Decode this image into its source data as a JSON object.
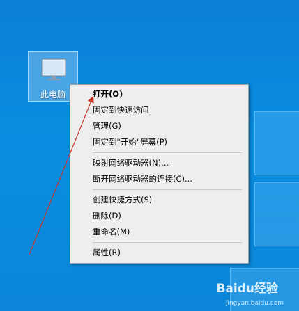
{
  "desktop": {
    "icon": {
      "label": "此电脑",
      "icon_name": "computer-monitor-icon"
    }
  },
  "context_menu": {
    "groups": [
      [
        {
          "label": "打开(O)",
          "bold": true
        },
        {
          "label": "固定到快速访问"
        },
        {
          "label": "管理(G)"
        },
        {
          "label": "固定到\"开始\"屏幕(P)"
        }
      ],
      [
        {
          "label": "映射网络驱动器(N)..."
        },
        {
          "label": "断开网络驱动器的连接(C)..."
        }
      ],
      [
        {
          "label": "创建快捷方式(S)"
        },
        {
          "label": "删除(D)"
        },
        {
          "label": "重命名(M)"
        }
      ],
      [
        {
          "label": "属性(R)"
        }
      ]
    ]
  },
  "annotation": {
    "color": "#c0392b"
  },
  "watermark": {
    "text": "Baidu经验",
    "sub": "jingyan.baidu.com"
  }
}
